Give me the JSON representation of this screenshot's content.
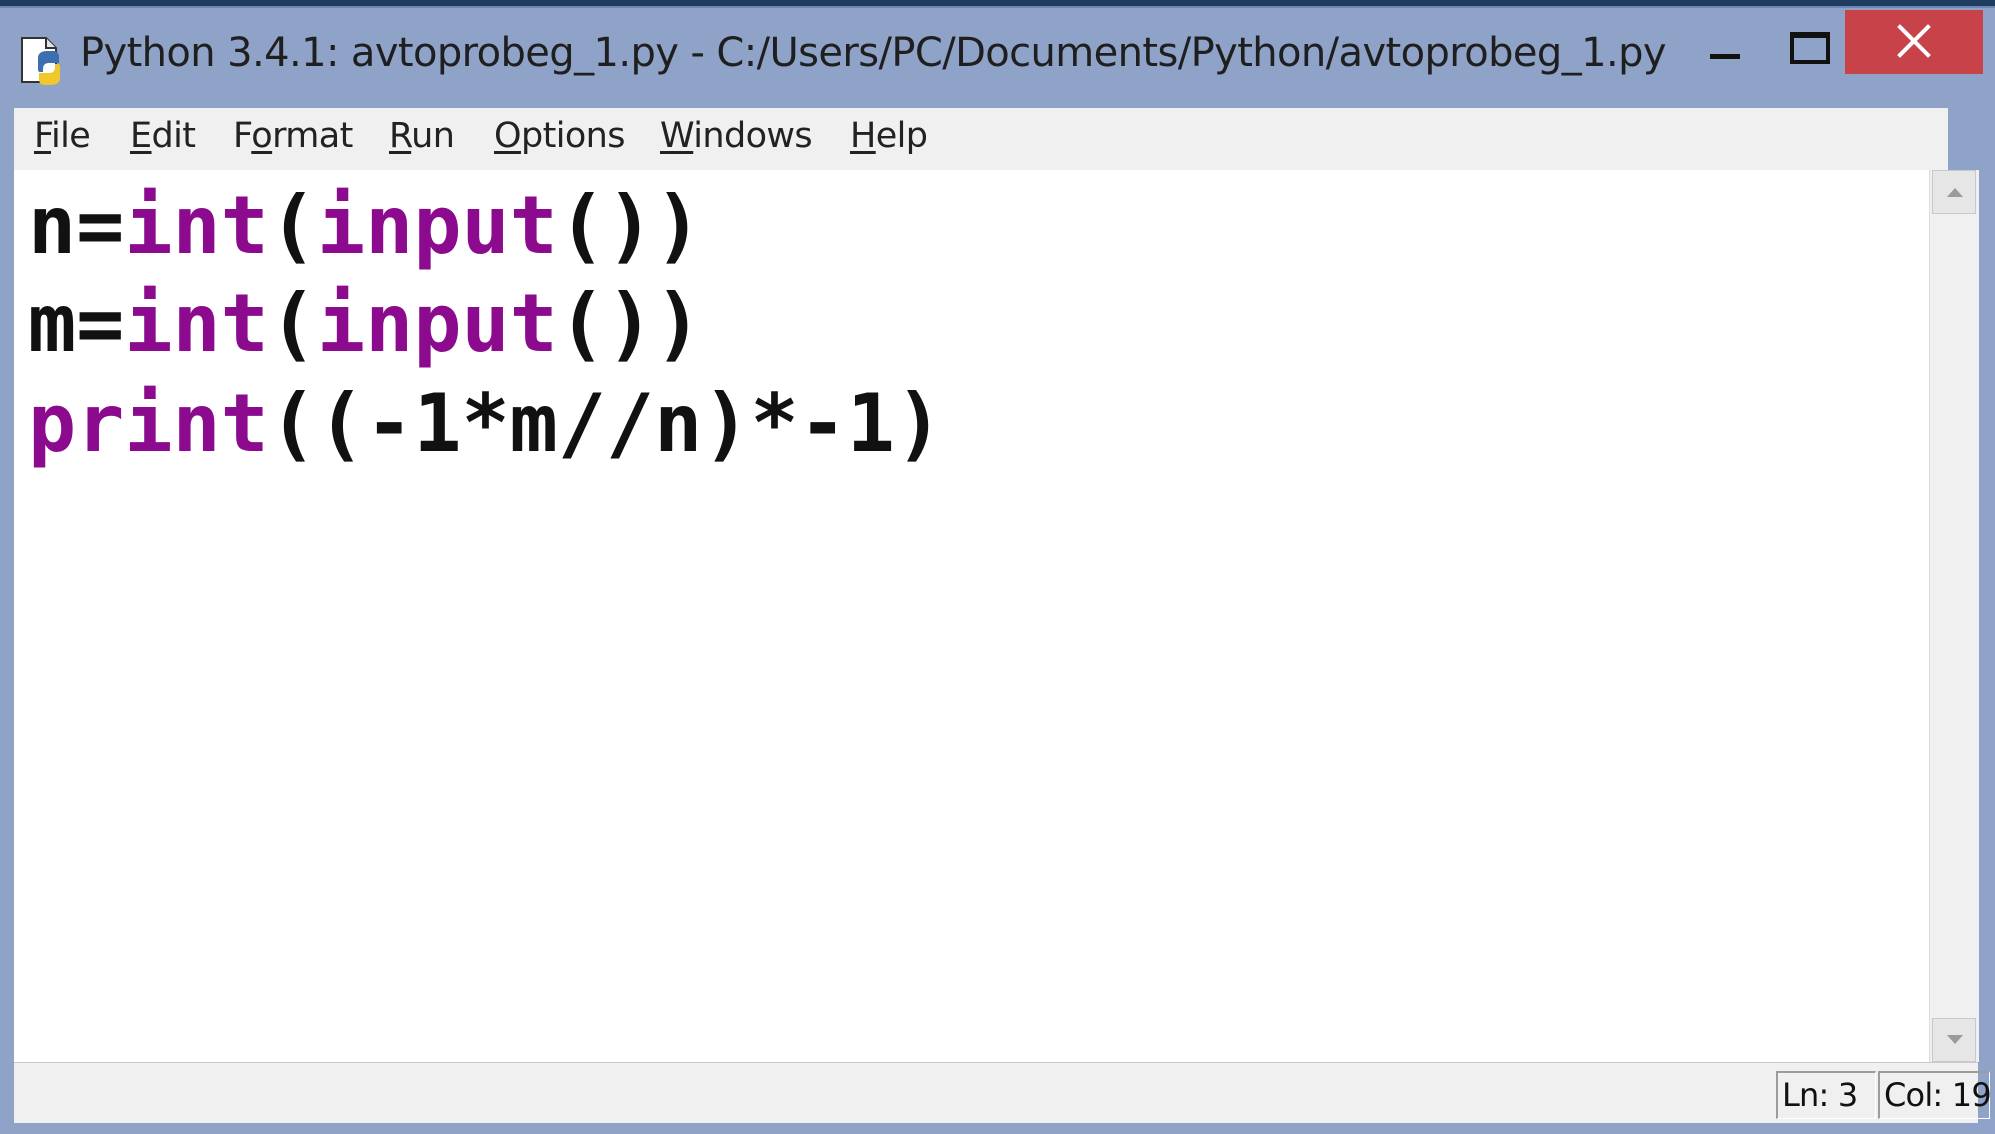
{
  "window": {
    "title": "Python 3.4.1: avtoprobeg_1.py - C:/Users/PC/Documents/Python/avtoprobeg_1.py",
    "icon": "python-file-icon"
  },
  "controls": {
    "minimize_icon": "minimize-icon",
    "maximize_icon": "maximize-icon",
    "close_icon": "close-icon",
    "close_color": "#c8424a"
  },
  "menu": {
    "file": {
      "prefix": "",
      "hot": "F",
      "rest": "ile"
    },
    "edit": {
      "prefix": "",
      "hot": "E",
      "rest": "dit"
    },
    "format": {
      "prefix": "F",
      "hot": "o",
      "rest": "rmat"
    },
    "run": {
      "prefix": "",
      "hot": "R",
      "rest": "un"
    },
    "options": {
      "prefix": "",
      "hot": "O",
      "rest": "ptions"
    },
    "windows": {
      "prefix": "",
      "hot": "W",
      "rest": "indows"
    },
    "help": {
      "prefix": "",
      "hot": "H",
      "rest": "elp"
    }
  },
  "code": {
    "line1": {
      "a": "n=",
      "kw1": "int",
      "b": "(",
      "kw2": "input",
      "c": "())"
    },
    "line2": {
      "a": "m=",
      "kw1": "int",
      "b": "(",
      "kw2": "input",
      "c": "())"
    },
    "line3": {
      "kw1": "print",
      "rest": "((-1*m//n)*-1)"
    }
  },
  "syntax_colors": {
    "keyword": "#8b0a8e",
    "default": "#111111"
  },
  "status": {
    "line": "Ln: 3",
    "column": "Col: 19"
  }
}
